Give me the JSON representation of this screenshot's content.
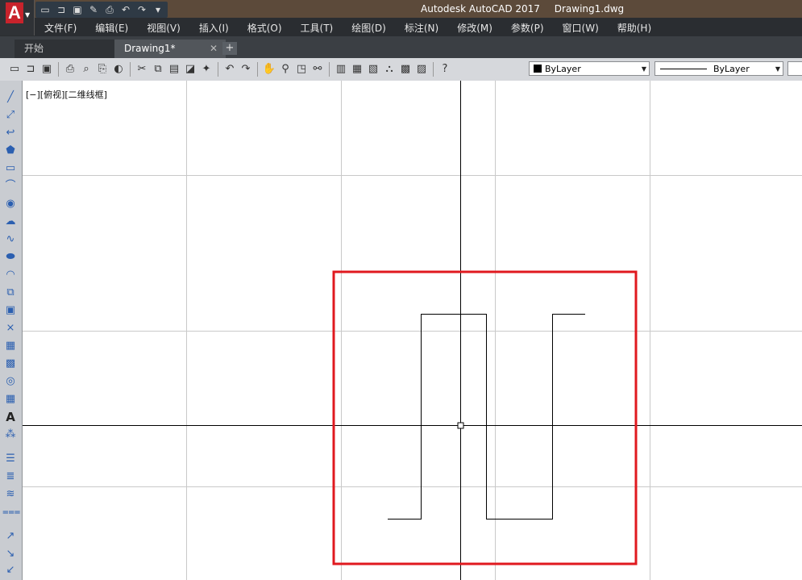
{
  "app": {
    "title": "Autodesk AutoCAD 2017",
    "filename": "Drawing1.dwg",
    "logo_letter": "A",
    "brand_color": "#c8232c"
  },
  "quick_access": [
    "new-icon",
    "open-icon",
    "save-icon",
    "saveas-icon",
    "print-icon",
    "undo-icon",
    "redo-icon",
    "customize-icon"
  ],
  "menu": [
    "文件(F)",
    "编辑(E)",
    "视图(V)",
    "插入(I)",
    "格式(O)",
    "工具(T)",
    "绘图(D)",
    "标注(N)",
    "修改(M)",
    "参数(P)",
    "窗口(W)",
    "帮助(H)"
  ],
  "tabs": [
    {
      "label": "开始",
      "active": false
    },
    {
      "label": "Drawing1*",
      "active": true,
      "close": "✕"
    }
  ],
  "tab_add": "+",
  "toolbar": {
    "layer_color": "ByLayer",
    "linetype": "ByLayer",
    "help": "?"
  },
  "viewport_label": "[−][俯视][二维线框]",
  "left_tools": [
    "line-icon",
    "construction-line-icon",
    "polyline-icon",
    "polygon-icon",
    "rectangle-icon",
    "arc-icon",
    "circle-icon",
    "revcloud-icon",
    "spline-icon",
    "ellipse-icon",
    "ellipse-arc-icon",
    "insert-block-icon",
    "make-block-icon",
    "point-icon",
    "hatch-icon",
    "gradient-icon",
    "region-icon",
    "table-icon",
    "text-icon",
    "add-selected-icon",
    "layer-icon",
    "layer-properties-icon",
    "layer-states-icon",
    "layer-walk-icon",
    "dimension-icon",
    "leader-icon",
    "multileader-icon"
  ],
  "colors": {
    "highlight_box": "#e0191f",
    "grid": "#c9c9c9",
    "axis": "#000000"
  }
}
